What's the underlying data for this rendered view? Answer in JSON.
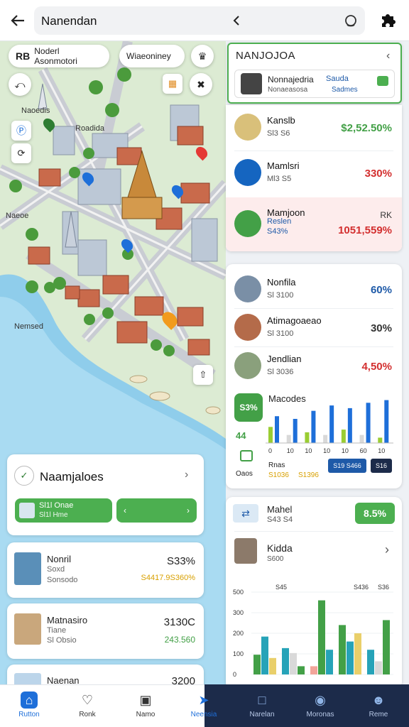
{
  "topbar": {
    "title": "Nanendan"
  },
  "map": {
    "chip_left": {
      "badge": "RB",
      "label": "Noderl Asonmotori"
    },
    "chip_right": {
      "label": "Wiaeoniney"
    },
    "place_labels": [
      "Naoedis",
      "Roadida",
      "Naeoe",
      "Nemsed"
    ],
    "pins": [
      {
        "color": "#2e7d32"
      },
      {
        "color": "#1e6fd9"
      },
      {
        "color": "#e53935"
      },
      {
        "color": "#1e6fd9"
      },
      {
        "color": "#1e6fd9"
      },
      {
        "color": "#f29b1d"
      }
    ]
  },
  "left_panel": {
    "nearby": {
      "title": "Naamjaloes",
      "bar_label": "Sl1l Onae",
      "bar_sub": "Sl1l Hme"
    },
    "items": [
      {
        "name": "Nonril",
        "sub1": "Soxd",
        "sub2": "Sonsodo",
        "value": "S33%",
        "sub_value": "S4417.9S360%",
        "sub_color": "#d8a000"
      },
      {
        "name": "Matnasiro",
        "sub1": "Tiane",
        "sub2": "Sl Obsio",
        "value": "3130C",
        "sub_value": "243.560",
        "sub_color": "#43a047"
      },
      {
        "name": "Naenan",
        "value": "3200"
      }
    ]
  },
  "right_panel": {
    "header": {
      "title": "NANJOJOA",
      "sub_title": "Nonnajedria",
      "sub_sub": "Nonaeasosa",
      "sub_badge": "Sauda",
      "sub_badge2": "Sadmes"
    },
    "list1": [
      {
        "name": "Kanslb",
        "sub": "Sl3 S6",
        "value": "$2,52.50%",
        "color": "#43a047",
        "thumb": "#d9c07a"
      },
      {
        "name": "Mamlsri",
        "sub": "Ml3 S5",
        "value": "330%",
        "color": "#d32f2f",
        "thumb": "#1565c0"
      },
      {
        "name": "Mamjoon",
        "sub": "Reslen",
        "sub2": "S43%",
        "value": "1051,559%",
        "value_top": "RK",
        "color": "#d32f2f",
        "thumb": "#43a047",
        "highlight": true
      }
    ],
    "list2": [
      {
        "name": "Nonfila",
        "sub": "Sl 3100",
        "value": "60%",
        "color": "#1e5aa8",
        "thumb": "#7a8fa6"
      },
      {
        "name": "Atimagoaeao",
        "sub": "Sl 3100",
        "value": "30%",
        "color": "#333",
        "thumb": "#b46b4a"
      },
      {
        "name": "Jendlian",
        "sub": "Sl 3036",
        "value": "4,50%",
        "color": "#d32f2f",
        "thumb": "#8aa07c"
      }
    ],
    "chart1": {
      "label": "Macodes",
      "badge": "S3%",
      "side_value": "44",
      "foot_left": "Oaos",
      "foot_mid1": "Rnas",
      "foot_mid2": "S1036",
      "foot_mid3": "S1396",
      "button1": "S19 S466",
      "button2": "S16",
      "ticks": [
        "0",
        "10",
        "10",
        "10",
        "10",
        "60",
        "10"
      ],
      "chart_data": {
        "type": "bar",
        "series": [
          {
            "values": [
              3,
              1.5,
              2,
              1.5,
              2.5,
              1.5,
              1
            ]
          },
          {
            "values": [
              5,
              4.5,
              6,
              7,
              6.5,
              7.5,
              8
            ]
          }
        ],
        "ylim": [
          0,
          9
        ]
      }
    },
    "card2": {
      "name": "Mahel",
      "sub": "S43 S4",
      "badge": "8.5%",
      "name2": "Kidda",
      "sub2": "S600"
    },
    "chart2": {
      "ylabels": [
        "500",
        "300",
        "200",
        "100",
        "0"
      ],
      "top_labels": [
        "S45",
        "S436",
        "S36"
      ],
      "chart_data": {
        "type": "bar",
        "series": [
          {
            "values": [
              1.2,
              1.6,
              0.5,
              3.0,
              1.5
            ]
          },
          {
            "values": [
              2.3,
              1.3,
              4.5,
              2.0,
              0.8
            ]
          },
          {
            "values": [
              1.0,
              0.5,
              1.5,
              2.5,
              3.3
            ]
          }
        ],
        "ylim": [
          0,
          5
        ]
      }
    }
  },
  "tabbar": {
    "tabs": [
      {
        "label": "Rutton",
        "icon": "home-icon",
        "active": true
      },
      {
        "label": "Ronk",
        "icon": "heart-icon"
      },
      {
        "label": "Namo",
        "icon": "calendar-icon"
      },
      {
        "label": "Neensia",
        "icon": "navigation-icon",
        "active": true
      },
      {
        "label": "Narelan",
        "icon": "square-icon"
      },
      {
        "label": "Moronas",
        "icon": "chat-icon"
      },
      {
        "label": "Reme",
        "icon": "user-icon"
      }
    ]
  },
  "colors": {
    "accent": "#1e6fd9",
    "green": "#4caf50",
    "dark_nav": "#1c2b4a"
  }
}
